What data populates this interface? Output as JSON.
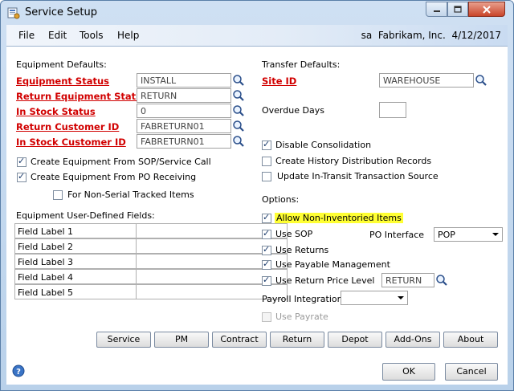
{
  "window": {
    "title": "Service Setup"
  },
  "menu": {
    "items": [
      "File",
      "Edit",
      "Tools",
      "Help"
    ],
    "user": "sa",
    "company": "Fabrikam, Inc.",
    "date": "4/12/2017"
  },
  "equipment_defaults": {
    "heading": "Equipment Defaults:",
    "fields": [
      {
        "label": "Equipment Status",
        "value": "INSTALL"
      },
      {
        "label": "Return Equipment Status",
        "value": "RETURN"
      },
      {
        "label": "In Stock Status",
        "value": "0"
      },
      {
        "label": "Return Customer ID",
        "value": "FABRETURN01"
      },
      {
        "label": "In Stock Customer ID",
        "value": "FABRETURN01"
      }
    ]
  },
  "equipment_options": {
    "create_from_sop": {
      "label": "Create Equipment From SOP/Service Call",
      "checked": true
    },
    "create_from_po": {
      "label": "Create Equipment From PO Receiving",
      "checked": true
    },
    "non_serial": {
      "label": "For Non-Serial Tracked Items",
      "checked": false
    }
  },
  "udf": {
    "heading": "Equipment User-Defined Fields:",
    "labels": [
      "Field Label 1",
      "Field Label 2",
      "Field Label 3",
      "Field Label 4",
      "Field Label 5"
    ]
  },
  "transfer_defaults": {
    "heading": "Transfer Defaults:",
    "site_id_label": "Site ID",
    "site_id_value": "WAREHOUSE",
    "overdue_label": "Overdue Days",
    "overdue_value": ""
  },
  "transfer_options": {
    "disable_consolidation": {
      "label": "Disable Consolidation",
      "checked": true
    },
    "history_distribution": {
      "label": "Create History Distribution Records",
      "checked": false
    },
    "update_in_transit": {
      "label": "Update In-Transit Transaction Source",
      "checked": false
    }
  },
  "options": {
    "heading": "Options:",
    "allow_non_inventoried": {
      "label": "Allow Non-Inventoried Items",
      "checked": true
    },
    "use_sop": {
      "label": "Use SOP",
      "checked": true
    },
    "po_interface_label": "PO Interface",
    "po_interface_value": "POP",
    "use_returns": {
      "label": "Use Returns",
      "checked": true
    },
    "use_payable": {
      "label": "Use Payable Management",
      "checked": true
    },
    "use_return_price": {
      "label": "Use Return Price Level",
      "checked": true
    },
    "return_price_value": "RETURN",
    "payroll_label": "Payroll Integration",
    "payroll_value": "",
    "use_payrate": {
      "label": "Use Payrate",
      "checked": false
    }
  },
  "buttons": {
    "service": "Service",
    "pm": "PM",
    "contract": "Contract",
    "return": "Return",
    "depot": "Depot",
    "addons": "Add-Ons",
    "about": "About",
    "ok": "OK",
    "cancel": "Cancel"
  },
  "colors": {
    "required_label": "#d10000",
    "highlight": "#ffff33",
    "window_frame": "#b9d1ea"
  }
}
